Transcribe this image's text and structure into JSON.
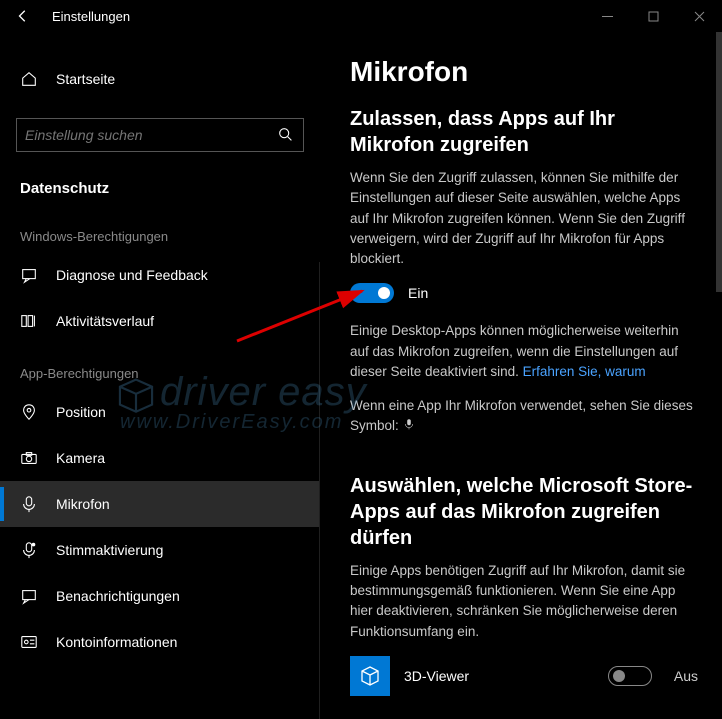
{
  "window": {
    "title": "Einstellungen"
  },
  "sidebar": {
    "home": "Startseite",
    "search_placeholder": "Einstellung suchen",
    "category": "Datenschutz",
    "group1_label": "Windows-Berechtigungen",
    "group1_items": [
      {
        "label": "Diagnose und Feedback"
      },
      {
        "label": "Aktivitätsverlauf"
      }
    ],
    "group2_label": "App-Berechtigungen",
    "group2_items": [
      {
        "label": "Position"
      },
      {
        "label": "Kamera"
      },
      {
        "label": "Mikrofon"
      },
      {
        "label": "Stimmaktivierung"
      },
      {
        "label": "Benachrichtigungen"
      },
      {
        "label": "Kontoinformationen"
      }
    ]
  },
  "main": {
    "title": "Mikrofon",
    "section1_heading": "Zulassen, dass Apps auf Ihr Mikrofon zugreifen",
    "section1_body": "Wenn Sie den Zugriff zulassen, können Sie mithilfe der Einstellungen auf dieser Seite auswählen, welche Apps auf Ihr Mikrofon zugreifen können. Wenn Sie den Zugriff verweigern, wird der Zugriff auf Ihr Mikrofon für Apps blockiert.",
    "toggle1_state": "Ein",
    "desktop_note_pre": "Einige Desktop-Apps können möglicherweise weiterhin auf das Mikrofon zugreifen, wenn die Einstellungen auf dieser Seite deaktiviert sind. ",
    "desktop_note_link": "Erfahren Sie, warum",
    "symbol_note": "Wenn eine App Ihr Mikrofon verwendet, sehen Sie dieses Symbol:",
    "section2_heading": "Auswählen, welche Microsoft Store-Apps auf das Mikrofon zugreifen dürfen",
    "section2_body": "Einige Apps benötigen Zugriff auf Ihr Mikrofon, damit sie bestimmungsgemäß funktionieren. Wenn Sie eine App hier deaktivieren, schränken Sie möglicherweise deren Funktionsumfang ein.",
    "apps": [
      {
        "name": "3D-Viewer",
        "state": "Aus"
      }
    ]
  },
  "watermark": {
    "line1": "driver easy",
    "line2": "www.DriverEasy.com"
  }
}
